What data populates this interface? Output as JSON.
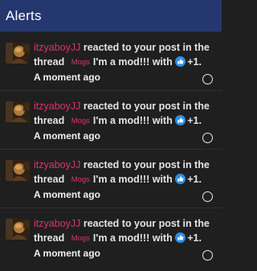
{
  "header": {
    "title": "Alerts"
  },
  "alerts": [
    {
      "username": "itzyaboyJJ",
      "action_text": " reacted to your post in the thread ",
      "prefix": "Mogs",
      "thread_title": "I'm a mod!!! with ",
      "reaction_icon": "like-icon",
      "reaction_count": "+1.",
      "time": "A moment ago"
    },
    {
      "username": "itzyaboyJJ",
      "action_text": " reacted to your post in the thread ",
      "prefix": "Mogs",
      "thread_title": "I'm a mod!!! with ",
      "reaction_icon": "like-icon",
      "reaction_count": "+1.",
      "time": "A moment ago"
    },
    {
      "username": "itzyaboyJJ",
      "action_text": " reacted to your post in the thread ",
      "prefix": "Mogs",
      "thread_title": "I'm a mod!!! with ",
      "reaction_icon": "like-icon",
      "reaction_count": "+1.",
      "time": "A moment ago"
    },
    {
      "username": "itzyaboyJJ",
      "action_text": " reacted to your post in the thread ",
      "prefix": "Mogs",
      "thread_title": "I'm a mod!!! with ",
      "reaction_icon": "like-icon",
      "reaction_count": "+1.",
      "time": "A moment ago"
    }
  ],
  "colors": {
    "header_bg": "#25376f",
    "panel_bg": "#1f1f1f",
    "username": "#d8356a",
    "like_blue": "#2b8fe8",
    "text": "#e4e4e4"
  }
}
